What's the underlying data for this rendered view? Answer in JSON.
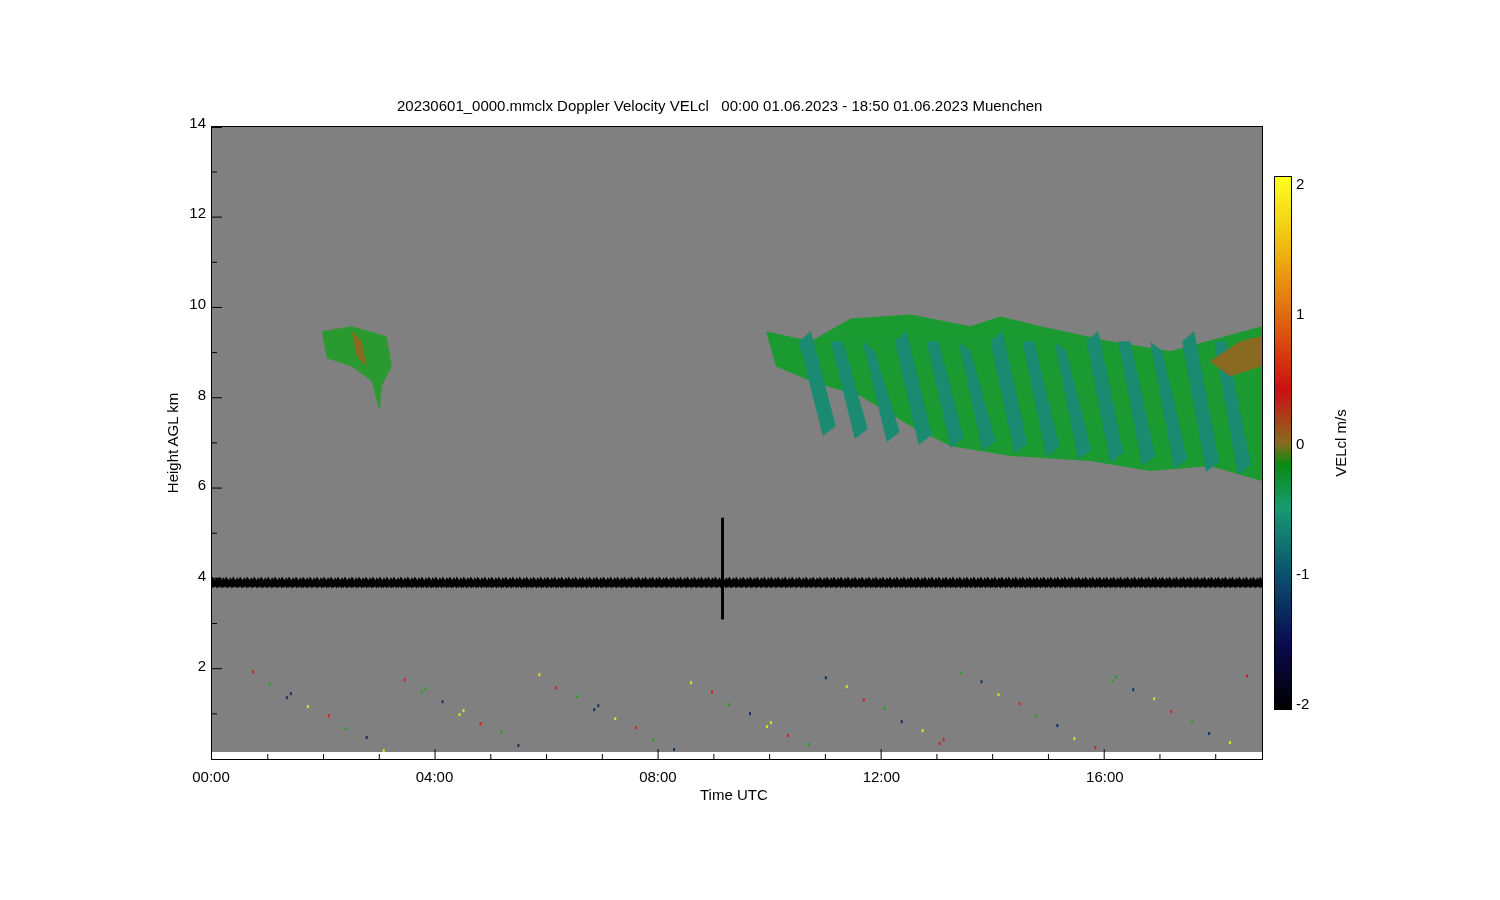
{
  "title": "20230601_0000.mmclx Doppler Velocity VELcl   00:00 01.06.2023 - 18:50 01.06.2023 Muenchen",
  "y_axis": {
    "label": "Height AGL km",
    "ticks": [
      "14",
      "12",
      "10",
      "8",
      "6",
      "4",
      "2"
    ]
  },
  "x_axis": {
    "label": "Time UTC",
    "ticks": [
      "00:00",
      "04:00",
      "08:00",
      "12:00",
      "16:00"
    ]
  },
  "colorbar": {
    "label": "VELcl m/s",
    "ticks": [
      "2",
      "1",
      "0",
      "-1",
      "-2"
    ]
  }
}
